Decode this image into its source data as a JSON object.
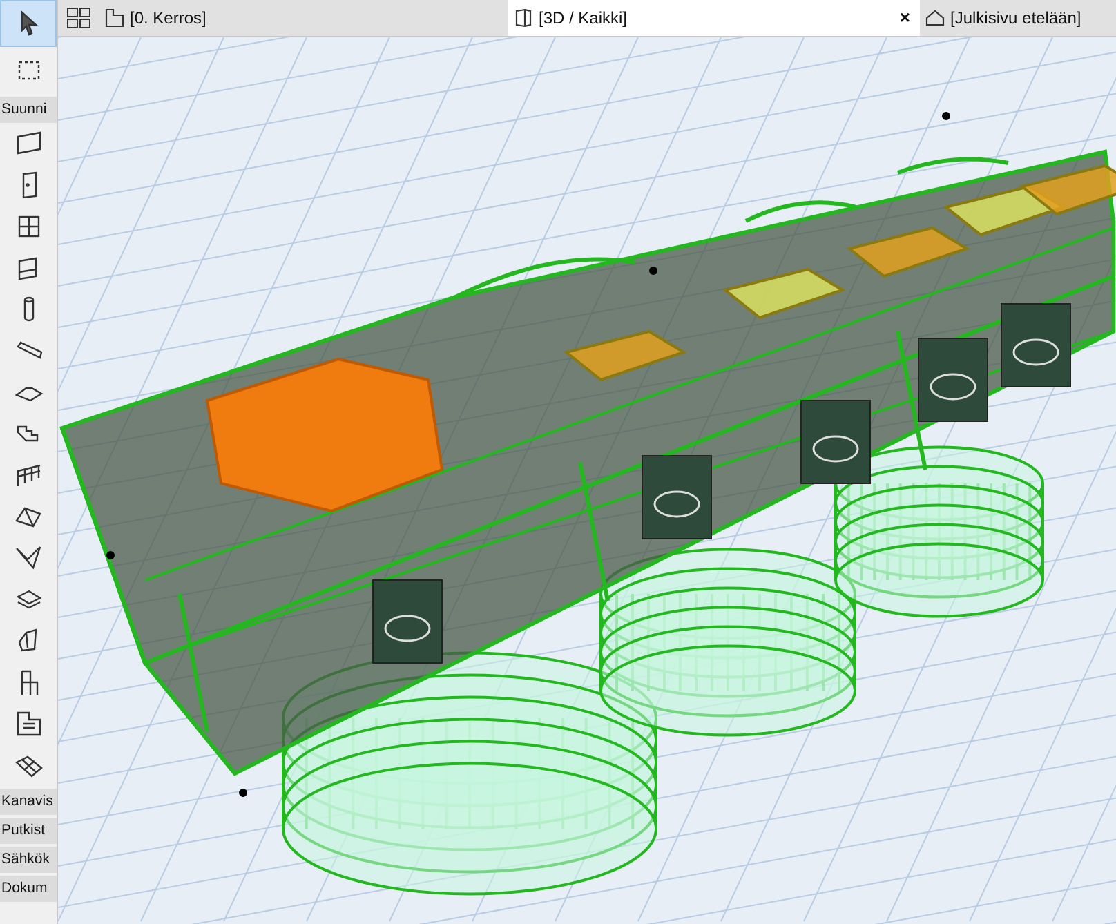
{
  "tabs": [
    {
      "label": "[0. Kerros]",
      "kind": "plan",
      "selected": false
    },
    {
      "label": "[3D / Kaikki]",
      "kind": "model",
      "selected": true,
      "close": "×"
    },
    {
      "label": "[Julkisivu etelään]",
      "kind": "elevation",
      "selected": false
    }
  ],
  "toolbox": {
    "pointer_tools": [
      {
        "selected": true
      },
      {
        "selected": false
      }
    ],
    "sections": [
      {
        "label": "Suunni"
      },
      {
        "label": "Kanavis"
      },
      {
        "label": "Putkist"
      },
      {
        "label": "Sähkök"
      },
      {
        "label": "Dokum"
      }
    ]
  }
}
